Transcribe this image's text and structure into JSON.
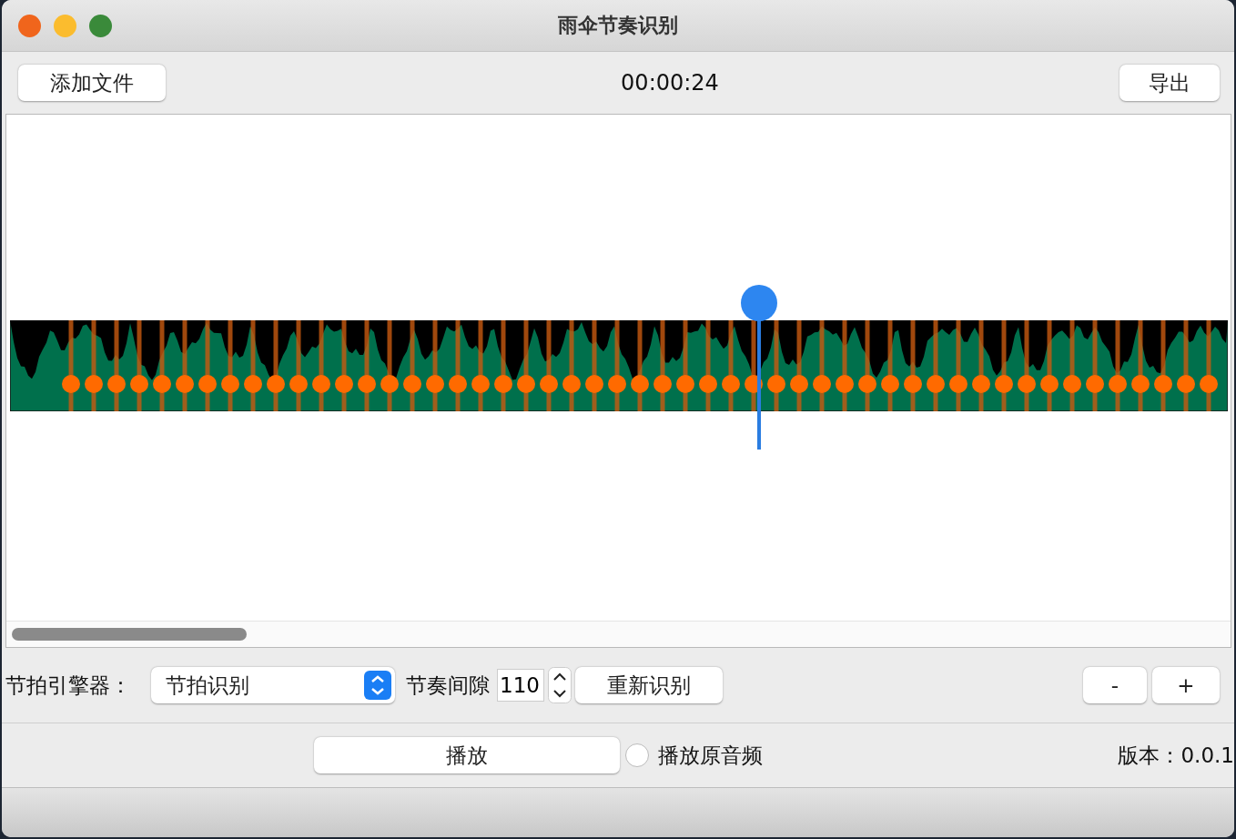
{
  "window": {
    "title": "雨伞节奏识别"
  },
  "toolbar": {
    "add_file_button": "添加文件",
    "time": "00:00:24",
    "export_button": "导出"
  },
  "timeline": {
    "playhead": {
      "level": 0.615
    }
  },
  "controls": {
    "engine_label": "节拍引擎器：",
    "engine_select": "节拍识别",
    "interval_label": "节奏间隙",
    "interval_value": "110",
    "redetect_button": "重新识别",
    "zoom_out_button": "-",
    "zoom_in_button": "+"
  },
  "playback": {
    "play_button": "播放",
    "original_audio": {
      "label": "播放原音频",
      "checked": false
    },
    "version": "版本：0.0.1"
  }
}
